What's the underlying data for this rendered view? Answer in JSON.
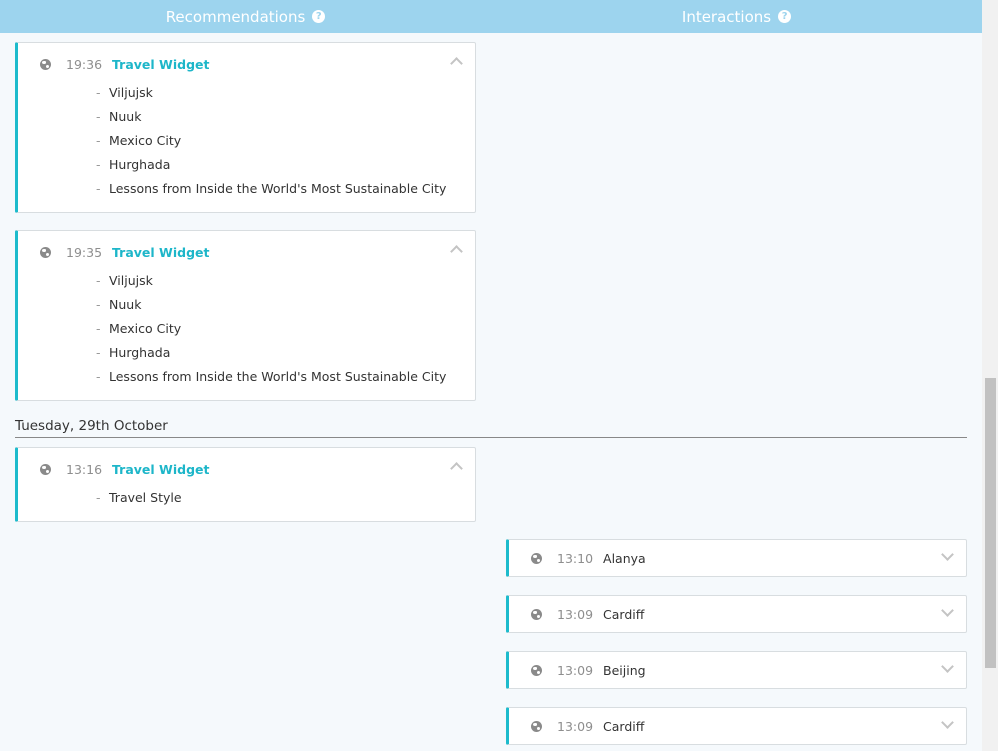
{
  "header": {
    "recommendations_label": "Recommendations",
    "interactions_label": "Interactions",
    "help_glyph": "?"
  },
  "recommendation_cards": [
    {
      "time": "19:36",
      "title": "Travel Widget",
      "items": [
        "Viljujsk",
        "Nuuk",
        "Mexico City",
        "Hurghada",
        "Lessons from Inside the World's Most Sustainable City"
      ]
    },
    {
      "time": "19:35",
      "title": "Travel Widget",
      "items": [
        "Viljujsk",
        "Nuuk",
        "Mexico City",
        "Hurghada",
        "Lessons from Inside the World's Most Sustainable City"
      ]
    },
    {
      "time": "13:16",
      "title": "Travel Widget",
      "items": [
        "Travel Style"
      ]
    }
  ],
  "date_separator": "Tuesday, 29th October",
  "interaction_cards": [
    {
      "time": "13:10",
      "city": "Alanya"
    },
    {
      "time": "13:09",
      "city": "Cardiff"
    },
    {
      "time": "13:09",
      "city": "Beijing"
    },
    {
      "time": "13:09",
      "city": "Cardiff"
    }
  ],
  "item_dash": "-",
  "icons": {
    "globe": "globe-icon",
    "help": "help-icon",
    "collapse": "chevron-up-icon",
    "expand": "chevron-down-icon"
  },
  "colors": {
    "header": "#9dd4ee",
    "accent": "#1dbbcc",
    "widget_title": "#1db6c9",
    "background": "#f5f9fc"
  }
}
